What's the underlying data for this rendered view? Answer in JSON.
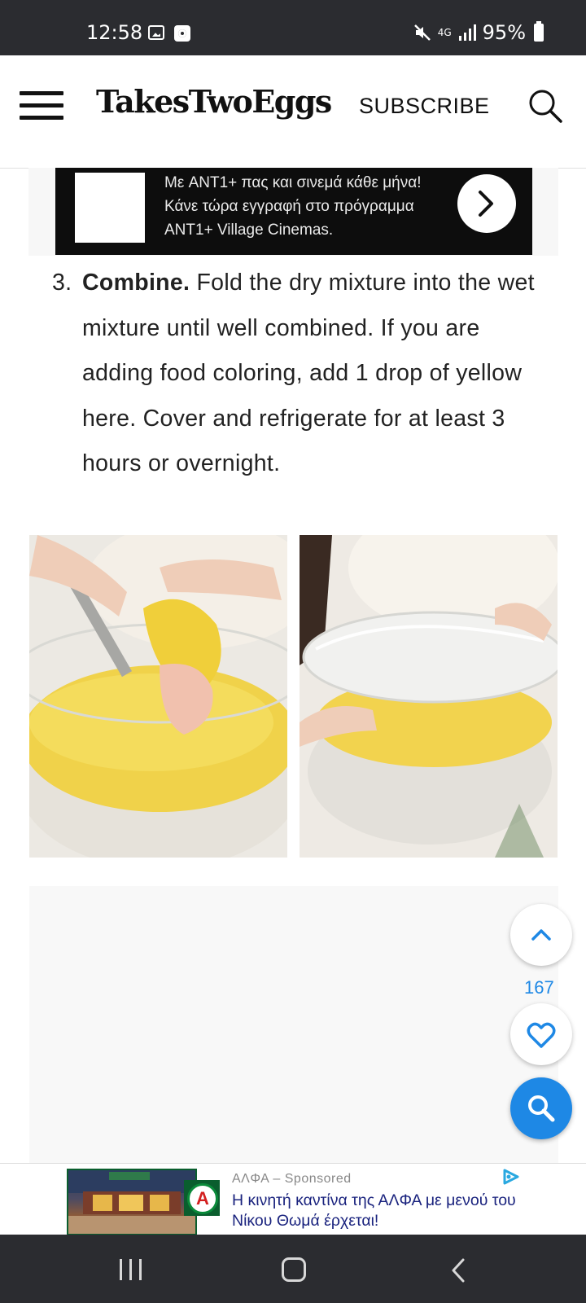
{
  "status_bar": {
    "time": "12:58",
    "network": "4G",
    "battery": "95%"
  },
  "header": {
    "logo": "TakesTwoEggs",
    "subscribe": "SUBSCRIBE"
  },
  "top_ad": {
    "text": "Με ANT1+ πας και σινεμά κάθε μήνα! Κάνε τώρα εγγραφή στο πρόγραμμα ANT1+ Village Cinemas."
  },
  "step": {
    "number": "3.",
    "title": "Combine.",
    "text": " Fold the dry mixture into the wet mixture until well combined. If you are adding food coloring, add 1 drop of yellow here. Cover and refrigerate for at least 3 hours or overnight."
  },
  "fab": {
    "like_count": "167"
  },
  "bottom_ad": {
    "advertiser": "ΑΛΦΑ",
    "sponsored": "Sponsored",
    "headline": "Η κινητή καντίνα της ΑΛΦΑ με μενού του Νίκου Θωμά έρχεται!",
    "logo_letter": "A"
  },
  "colors": {
    "accent": "#1e88e5",
    "status_bar": "#2b2c30"
  }
}
